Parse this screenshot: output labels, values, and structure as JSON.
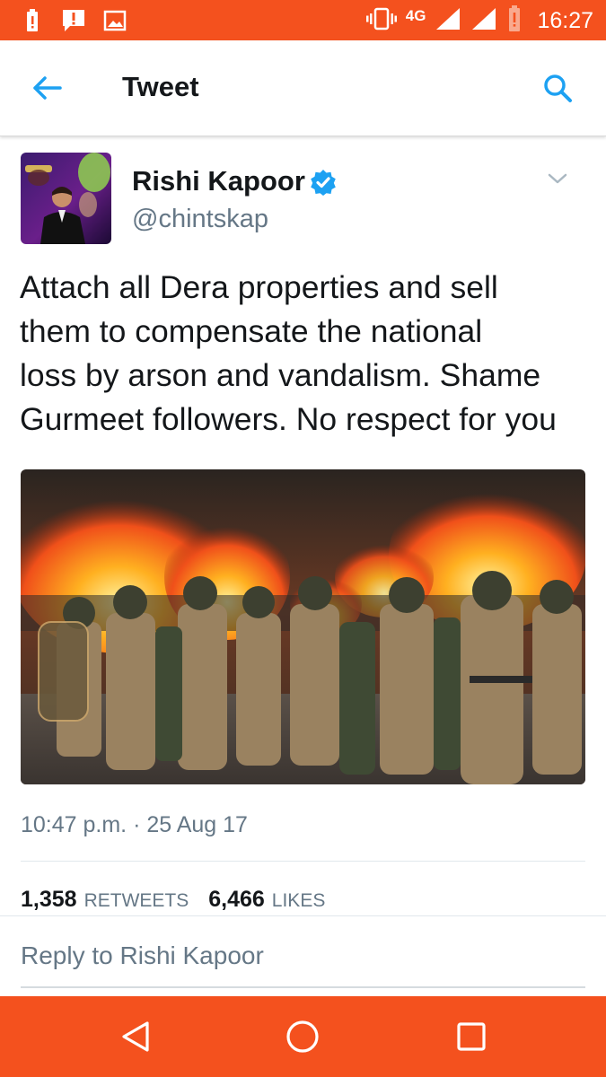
{
  "status_bar": {
    "network": "4G",
    "time": "16:27",
    "icons": [
      "battery-alert-icon",
      "notification-alert-icon",
      "image-notification-icon",
      "vibrate-icon",
      "signal-icon",
      "signal-icon",
      "battery-low-icon"
    ]
  },
  "app_bar": {
    "title": "Tweet",
    "icons": [
      "back-arrow-icon",
      "search-icon"
    ]
  },
  "tweet": {
    "author_name": "Rishi Kapoor",
    "verified": true,
    "handle": "@chintskap",
    "text": "Attach all Dera properties and sell\nthem to compensate the national\nloss by arson and vandalism. Shame\nGurmeet followers. No respect for you",
    "timestamp": "10:47 p.m. · 25 Aug 17",
    "retweets_count": "1,358",
    "retweets_label": "RETWEETS",
    "likes_count": "6,466",
    "likes_label": "LIKES",
    "reply_placeholder": "Reply to Rishi Kapoor"
  },
  "nav_bar": {
    "icons": [
      "back-triangle-icon",
      "home-circle-icon",
      "recents-square-icon"
    ]
  },
  "colors": {
    "accent_bar": "#f4511e",
    "twitter_blue": "#1da1f2",
    "text_primary": "#14171a",
    "text_secondary": "#657786"
  }
}
